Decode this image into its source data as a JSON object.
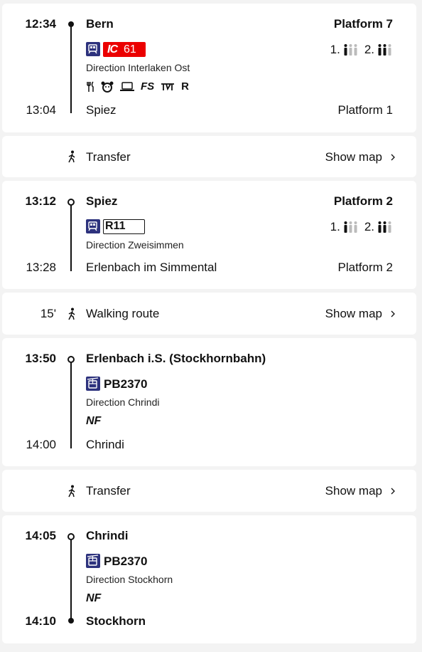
{
  "legs": [
    {
      "dep_time": "12:34",
      "dep_stop": "Bern",
      "dep_platform": "Platform 7",
      "line_type": "IC",
      "line_number": "61",
      "direction": "Direction Interlaken Ost",
      "services": [
        "restaurant-icon",
        "family-zone-icon",
        "business-zone-icon",
        "FS",
        "bike-icon",
        "R"
      ],
      "occupancy": {
        "first": "1.",
        "second": "2."
      },
      "arr_time": "13:04",
      "arr_stop": "Spiez",
      "arr_platform": "Platform 1"
    },
    {
      "dep_time": "13:12",
      "dep_stop": "Spiez",
      "dep_platform": "Platform 2",
      "line_label": "R11",
      "direction": "Direction Zweisimmen",
      "occupancy": {
        "first": "1.",
        "second": "2."
      },
      "arr_time": "13:28",
      "arr_stop": "Erlenbach im Simmental",
      "arr_platform": "Platform 2"
    },
    {
      "dep_time": "13:50",
      "dep_stop": "Erlenbach i.S. (Stockhornbahn)",
      "line_label": "PB2370",
      "direction": "Direction Chrindi",
      "note": "NF",
      "arr_time": "14:00",
      "arr_stop": "Chrindi"
    },
    {
      "dep_time": "14:05",
      "dep_stop": "Chrindi",
      "line_label": "PB2370",
      "direction": "Direction Stockhorn",
      "note": "NF",
      "arr_time": "14:10",
      "arr_stop": "Stockhorn"
    }
  ],
  "transfers": [
    {
      "label": "Transfer",
      "duration": "",
      "action": "Show map"
    },
    {
      "label": "Walking route",
      "duration": "15'",
      "action": "Show map"
    },
    {
      "label": "Transfer",
      "duration": "",
      "action": "Show map"
    }
  ],
  "colors": {
    "accent_red": "#eb0000",
    "sbb_blue": "#2d327d"
  }
}
